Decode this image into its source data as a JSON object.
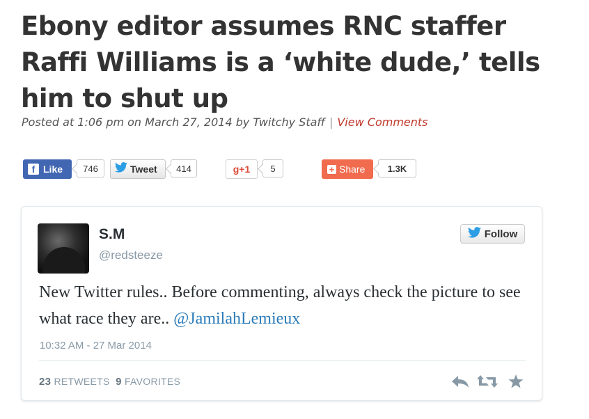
{
  "article": {
    "headline": "Ebony editor assumes RNC staffer Raffi Williams is a ‘white dude,’ tells him to shut up",
    "byline": "Posted at 1:06 pm on March 27, 2014 by Twitchy Staff",
    "separator": "|",
    "comments_link": "View Comments"
  },
  "share_bar": {
    "facebook": {
      "label": "Like",
      "count": "746",
      "icon": "facebook-f-icon"
    },
    "twitter": {
      "label": "Tweet",
      "count": "414",
      "icon": "twitter-bird-icon"
    },
    "google_plus": {
      "label": "g+1",
      "count": "5"
    },
    "share": {
      "label": "Share",
      "count": "1.3K",
      "icon": "plus-square-icon"
    }
  },
  "tweet": {
    "name": "S.M",
    "handle": "@redsteeze",
    "follow_label": "Follow",
    "text": "New Twitter rules.. Before commenting, always check the picture to see what race they are.. ",
    "mention": "@JamilahLemieux",
    "timestamp": "10:32 AM - 27 Mar 2014",
    "retweets_count": "23",
    "retweets_label": "RETWEETS",
    "favorites_count": "9",
    "favorites_label": "FAVORITES",
    "actions": [
      "reply-icon",
      "retweet-icon",
      "favorite-star-icon"
    ]
  },
  "colors": {
    "facebook": "#4267b2",
    "share": "#f16b4e",
    "link_red": "#c0392b",
    "twitter_blue": "#2b9ee5",
    "mention_blue": "#2b7bb9"
  }
}
